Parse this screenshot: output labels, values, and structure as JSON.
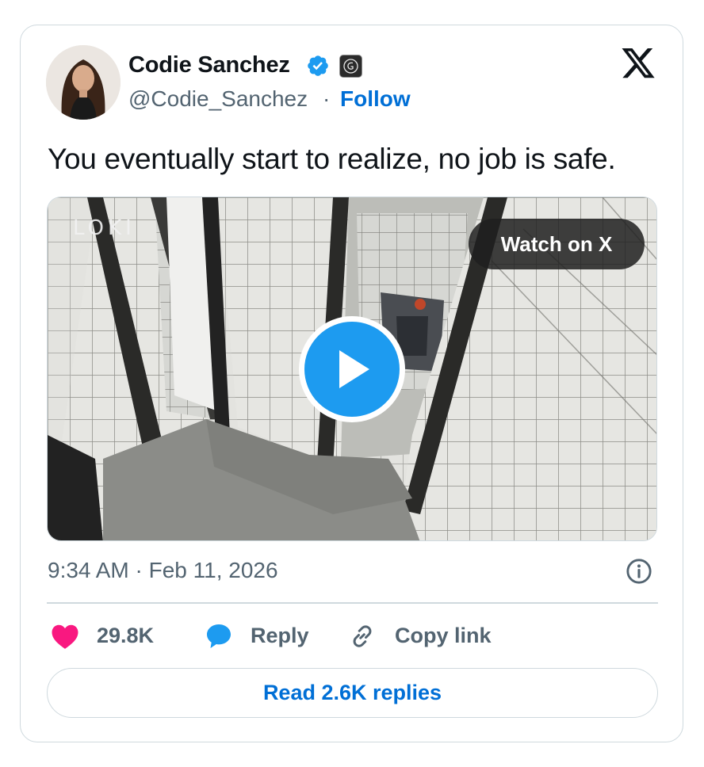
{
  "author": {
    "name": "Codie Sanchez",
    "handle": "@Codie_Sanchez",
    "separator": "·",
    "follow_label": "Follow"
  },
  "tweet": {
    "text": "You eventually start to realize, no job is safe.",
    "timestamp": "9:34 AM · Feb 11, 2026"
  },
  "media": {
    "watermark": "LOKI",
    "watch_label": "Watch on X"
  },
  "actions": {
    "like_count": "29.8K",
    "reply_label": "Reply",
    "copy_link_label": "Copy link",
    "read_replies_label": "Read 2.6K replies"
  },
  "icons": {
    "verified": "verified-badge-icon",
    "affiliate": "affiliate-badge-icon",
    "logo": "x-logo-icon",
    "play": "play-icon",
    "info": "info-icon",
    "like": "heart-icon",
    "reply": "speech-bubble-icon",
    "link": "link-icon"
  },
  "colors": {
    "link_blue": "#006fd6",
    "play_blue": "#1d9bf0",
    "heart_pink": "#f91880",
    "text": "#0f1419",
    "secondary_text": "#536471",
    "border": "#cfd9de"
  }
}
